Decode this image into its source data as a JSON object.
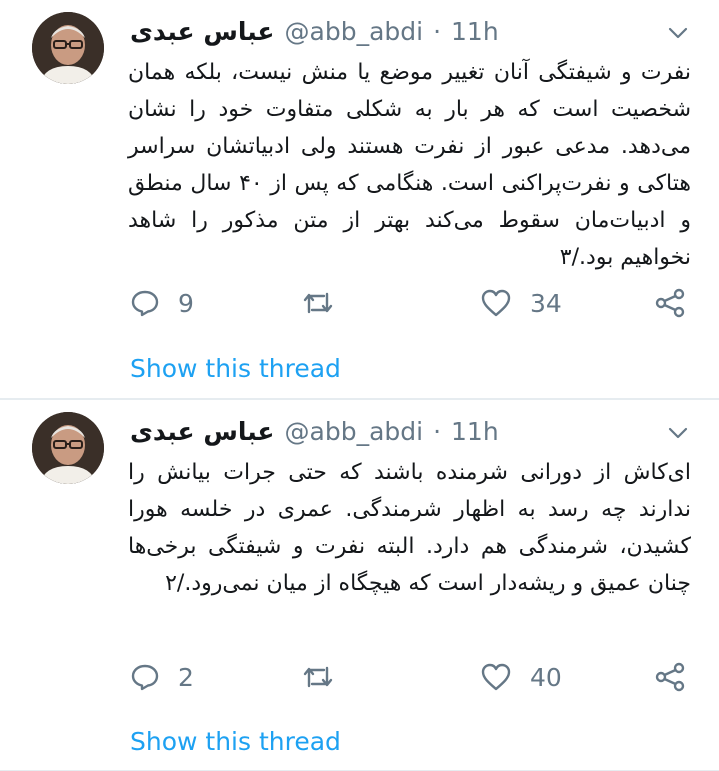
{
  "tweets": [
    {
      "display_name": "عباس عبدی",
      "handle": "@abb_abdi",
      "separator": "·",
      "time": "11h",
      "text": "نفرت و شیفتگی آنان تغییر موضع یا منش نیست، بلکه همان شخصیت است که هر بار به شکلی متفاوت خود را نشان می‌دهد. مدعی عبور از نفرت هستند ولی ادبیاتشان سراسر هتاکی و نفرت‌پراکنی است. هنگامی که پس از ۴۰ سال منطق و ادبیات‌مان سقوط می‌کند بهتر از متن مذکور را شاهد نخواهیم بود./۳",
      "reply_count": "9",
      "like_count": "34",
      "show_thread": "Show this thread"
    },
    {
      "display_name": "عباس عبدی",
      "handle": "@abb_abdi",
      "separator": "·",
      "time": "11h",
      "text": "ای‌کاش از دورانی شرمنده باشند که حتی جرات بیانش را ندارند چه رسد به اظهار شرمندگی. عمری در خلسه هورا کشیدن، شرمندگی هم دارد. البته نفرت و شیفتگی برخی‌ها چنان عمیق و ریشه‌دار است که هیچگاه از میان نمی‌رود./۲",
      "reply_count": "2",
      "like_count": "40",
      "show_thread": "Show this thread"
    }
  ],
  "icons": {
    "reply": "reply-icon",
    "retweet": "retweet-icon",
    "like": "heart-icon",
    "share": "share-icon",
    "more": "chevron-down-icon"
  },
  "colors": {
    "text": "#14171a",
    "muted": "#657786",
    "link": "#1da1f2",
    "divider": "#e6ecf0"
  }
}
